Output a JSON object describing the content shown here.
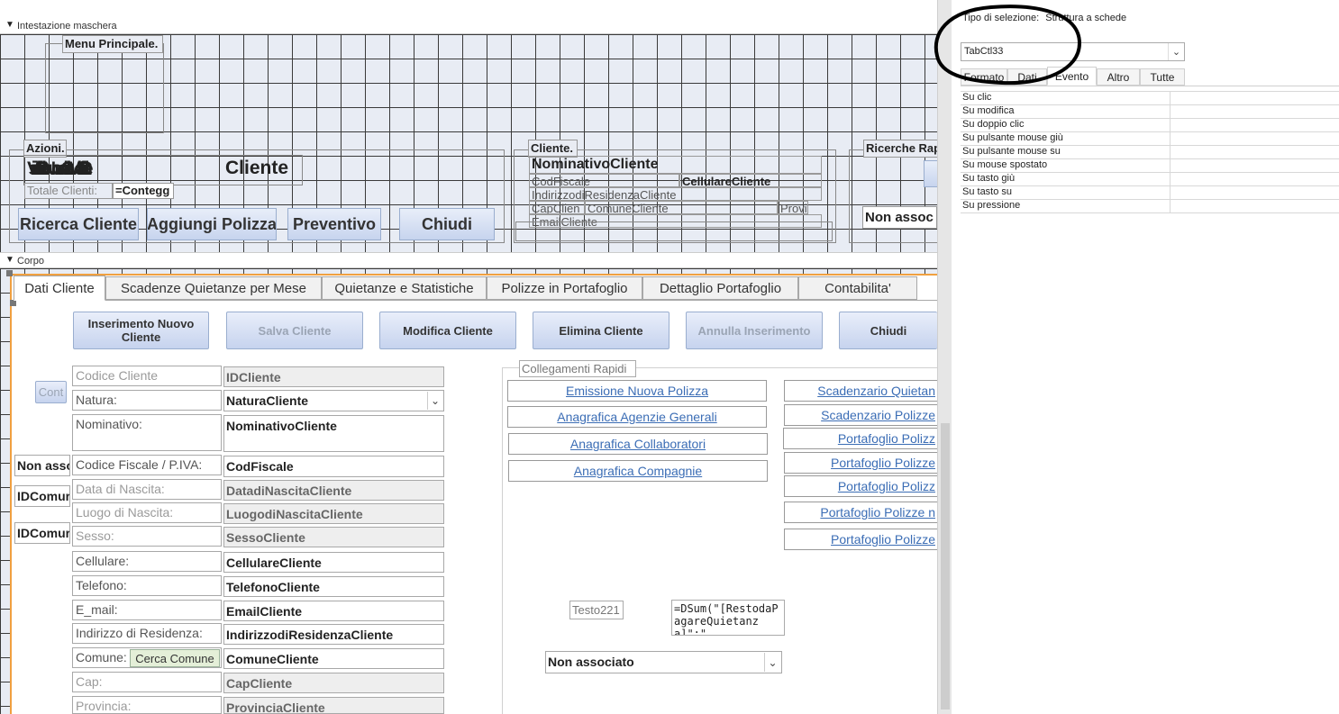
{
  "form_header": {
    "section_label": "Intestazione maschera",
    "menu_title": "Menu Principale.",
    "azioni_label": "Azioni.",
    "overlap_text": "VisualizzaClienteNuovoClienteModificaCliente",
    "overlap_tail": "Cliente",
    "totale_label": "Totale Clienti:",
    "totale_value": "=Contegg",
    "buttons": [
      "Ricerca Cliente",
      "Aggiungi Polizza",
      "Preventivo",
      "Chiudi"
    ],
    "cliente_label": "Cliente.",
    "nominativo": "NominativoCliente",
    "codfiscale": "CodFiscale",
    "cellulare": "CellulareCliente",
    "indirizzo": "IndirizzodiResidenzaCliente",
    "cap": "CapClien",
    "comune": "ComuneCliente",
    "prov": "Provi",
    "email": "EmailCliente",
    "ricerche_label": "Ricerche Rap",
    "non_assoc": "Non assoc"
  },
  "body": {
    "section_label": "Corpo",
    "tabs": [
      "Dati Cliente",
      "Scadenze Quietanze per Mese",
      "Quietanze e Statistiche",
      "Polizze in Portafoglio",
      "Dettaglio Portafoglio",
      "Contabilita'"
    ],
    "action_buttons": [
      "Inserimento Nuovo Cliente",
      "Salva Cliente",
      "Modifica Cliente",
      "Elimina Cliente",
      "Annulla Inserimento",
      "Chiudi"
    ],
    "cont_button": "Cont",
    "left_overflow": [
      "Non asso",
      "IDComur",
      "IDComur"
    ],
    "rows": [
      {
        "label": "Codice Cliente",
        "value": "IDCliente"
      },
      {
        "label": "Natura:",
        "value": "NaturaCliente"
      },
      {
        "label": "Nominativo:",
        "value": "NominativoCliente"
      },
      {
        "label": "Codice Fiscale / P.IVA:",
        "value": "CodFiscale"
      },
      {
        "label": "Data di Nascita:",
        "value": "DatadiNascitaCliente"
      },
      {
        "label": "Luogo di Nascita:",
        "value": "LuogodiNascitaCliente"
      },
      {
        "label": "Sesso:",
        "value": "SessoCliente"
      },
      {
        "label": "Cellulare:",
        "value": "CellulareCliente"
      },
      {
        "label": "Telefono:",
        "value": "TelefonoCliente"
      },
      {
        "label": "E_mail:",
        "value": "EmailCliente"
      },
      {
        "label": "Indirizzo di Residenza:",
        "value": "IndirizzodiResidenzaCliente"
      },
      {
        "label": "Comune:",
        "value": "ComuneCliente"
      },
      {
        "label": "Cap:",
        "value": "CapCliente"
      },
      {
        "label": "Provincia:",
        "value": "ProvinciaCliente"
      }
    ],
    "cerca_comune": "Cerca Comune",
    "collegamenti_label": "Collegamenti Rapidi",
    "links_left": [
      "Emissione Nuova Polizza",
      "Anagrafica Agenzie Generali",
      "Anagrafica Collaboratori",
      "Anagrafica Compagnie"
    ],
    "links_right": [
      "Scadenzario Quietan",
      "Scadenzario Polizze",
      "Portafoglio Polizz",
      "Portafoglio Polizze",
      "Portafoglio Polizz",
      "Portafoglio Polizze n",
      "Portafoglio Polizze"
    ],
    "testo_label": "Testo221",
    "dsum": "=DSum(\"[RestodaPagareQuietanza]\";\"",
    "combo_value": "Non associato"
  },
  "property_sheet": {
    "selection_label": "Tipo di selezione:",
    "selection_type": "Struttura a schede",
    "object": "TabCtl33",
    "tabs": [
      "Formato",
      "Dati",
      "Evento",
      "Altro",
      "Tutte"
    ],
    "active_tab": "Evento",
    "properties": [
      "Su clic",
      "Su modifica",
      "Su doppio clic",
      "Su pulsante mouse giù",
      "Su pulsante mouse su",
      "Su mouse spostato",
      "Su tasto giù",
      "Su tasto su",
      "Su pressione"
    ]
  }
}
